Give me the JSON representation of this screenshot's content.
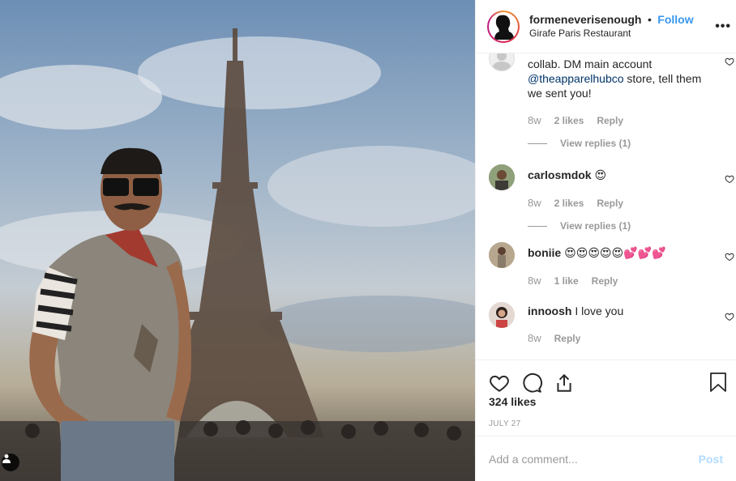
{
  "post": {
    "username": "formeneverisenough",
    "follow_label": "Follow",
    "separator": "•",
    "location": "Girafe Paris Restaurant",
    "more_label": "•••"
  },
  "comments": [
    {
      "username": "",
      "text_partial_top": "...............  .................",
      "text_lines": [
        "collab. DM main account"
      ],
      "mention": "@theapparelhubco",
      "text_after_mention": " store, tell them",
      "text_last": "we sent you!",
      "time": "8w",
      "likes": "2 likes",
      "reply_label": "Reply",
      "view_replies": "View replies (1)"
    },
    {
      "username": "carlosmdok",
      "text": "😍",
      "time": "8w",
      "likes": "2 likes",
      "reply_label": "Reply",
      "view_replies": "View replies (1)"
    },
    {
      "username": "boniie",
      "text": "😍😍😍😍😍💕💕💕",
      "time": "8w",
      "likes": "1 like",
      "reply_label": "Reply"
    },
    {
      "username": "innoosh",
      "text": "I love you",
      "time": "8w",
      "reply_label": "Reply"
    }
  ],
  "likes_count": "324 likes",
  "date": "JULY 27",
  "add_comment": {
    "placeholder": "Add a comment...",
    "post_label": "Post"
  },
  "icons": {
    "like": "heart-icon",
    "comment": "comment-icon",
    "share": "share-icon",
    "save": "bookmark-icon",
    "tag": "person-tag-icon"
  },
  "colors": {
    "follow": "#3897f0",
    "post_disabled": "#b3dbff",
    "muted": "#999999",
    "mention": "#003569"
  }
}
